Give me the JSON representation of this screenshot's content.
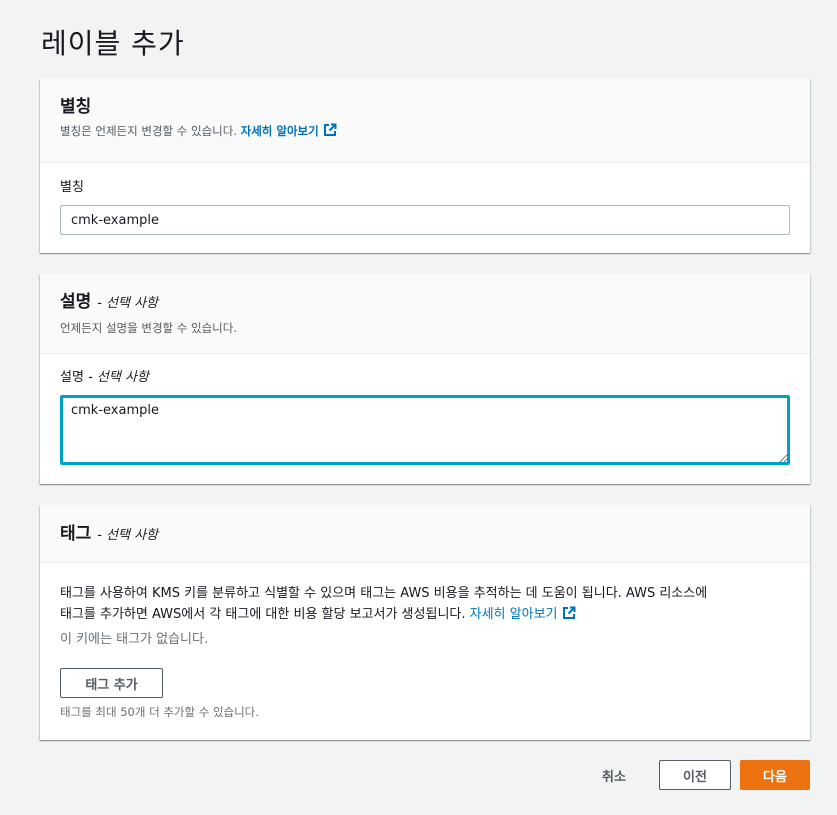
{
  "page": {
    "title": "레이블 추가"
  },
  "alias": {
    "heading": "별칭",
    "description": "별칭은 언제든지 변경할 수 있습니다.",
    "learn_more": "자세히 알아보기",
    "field_label": "별칭",
    "value": "cmk-example"
  },
  "description_panel": {
    "heading": "설명",
    "optional": "- 선택 사항",
    "description": "언제든지 설명을 변경할 수 있습니다.",
    "field_label": "설명",
    "field_optional": "- 선택 사항",
    "value": "cmk-example"
  },
  "tags": {
    "heading": "태그",
    "optional": "- 선택 사항",
    "text_line1": "태그를 사용하여 KMS 키를 분류하고 식별할 수 있으며 태그는 AWS 비용을 추적하는 데 도움이 됩니다. AWS 리소스에",
    "text_line2": "태그를 추가하면 AWS에서 각 태그에 대한 비용 할당 보고서가 생성됩니다.",
    "learn_more": "자세히 알아보기",
    "empty": "이 키에는 태그가 없습니다.",
    "add_button": "태그 추가",
    "limit_note": "태그를 최대 50개 더 추가할 수 있습니다."
  },
  "footer": {
    "cancel": "취소",
    "previous": "이전",
    "next": "다음"
  },
  "colors": {
    "primary": "#ec7211",
    "link": "#0073bb",
    "focus": "#00a1c9"
  }
}
